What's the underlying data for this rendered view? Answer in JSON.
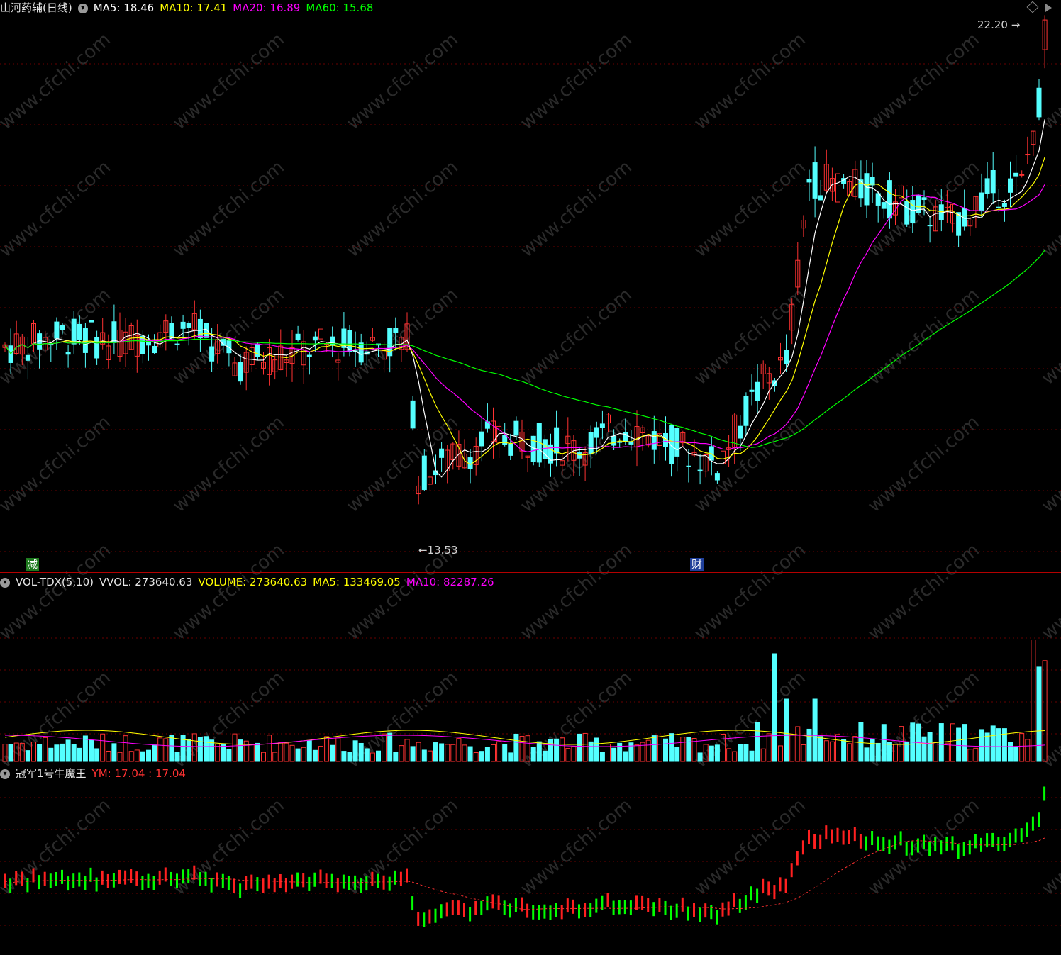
{
  "main_panel": {
    "title": "山河药辅(日线)",
    "ma5_label": "MA5: 18.46",
    "ma10_label": "MA10: 17.41",
    "ma20_label": "MA20: 16.89",
    "ma60_label": "MA60: 15.68",
    "high_marker": "22.20",
    "low_marker": "13.53",
    "badge_reduce": "减",
    "badge_finance": "财"
  },
  "volume_panel": {
    "title": "VOL-TDX(5,10)",
    "vvol_label": "VVOL: 273640.63",
    "volume_label": "VOLUME: 273640.63",
    "ma5_label": "MA5: 133469.05",
    "ma10_label": "MA10: 82287.26"
  },
  "indicator_panel": {
    "title": "冠军1号牛魔王",
    "ym_label": "YM: 17.04  : 17.04"
  },
  "watermark": "www.cfchi.com",
  "colors": {
    "up": "#ff3232",
    "down": "#54ffff",
    "ma5": "#ffffff",
    "ma10": "#ffff00",
    "ma20": "#ff00ff",
    "ma60": "#00ff00",
    "indicator_up": "#ff2020",
    "indicator_down": "#00ff00"
  },
  "chart_data": {
    "type": "candlestick",
    "y_range_price": [
      12.9,
      22.6
    ],
    "price_gridlines": true,
    "series": [
      {
        "name": "MA5",
        "last": 18.46
      },
      {
        "name": "MA10",
        "last": 17.41
      },
      {
        "name": "MA20",
        "last": 16.89
      },
      {
        "name": "MA60",
        "last": 15.68
      }
    ],
    "annotations": [
      {
        "text": "22.20",
        "kind": "high"
      },
      {
        "text": "13.53",
        "kind": "low"
      }
    ]
  }
}
